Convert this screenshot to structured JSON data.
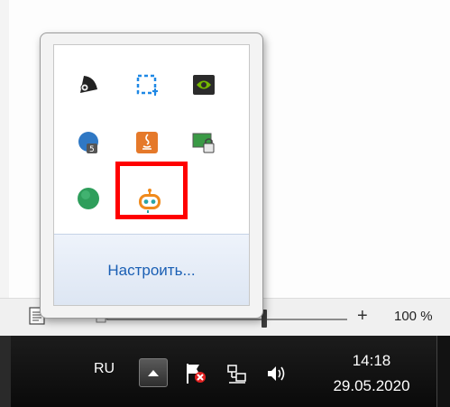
{
  "statusbar": {
    "zoom_plus": "+",
    "zoom_level": "100 %"
  },
  "taskbar": {
    "language": "RU",
    "time": "14:18",
    "date": "29.05.2020"
  },
  "tray_popup": {
    "customize_link": "Настроить...",
    "icons": [
      {
        "name": "tray-app-dark-icon"
      },
      {
        "name": "screenshot-selection-icon"
      },
      {
        "name": "nvidia-icon"
      },
      {
        "name": "badge-5-app-icon"
      },
      {
        "name": "java-update-icon"
      },
      {
        "name": "locked-monitor-icon"
      },
      {
        "name": "green-circle-icon"
      },
      {
        "name": "robot-app-icon"
      }
    ],
    "highlight_color": "#ff0000"
  },
  "colors": {
    "taskbar": "#111111",
    "link": "#1a5fb4",
    "highlight": "#ff0000"
  }
}
